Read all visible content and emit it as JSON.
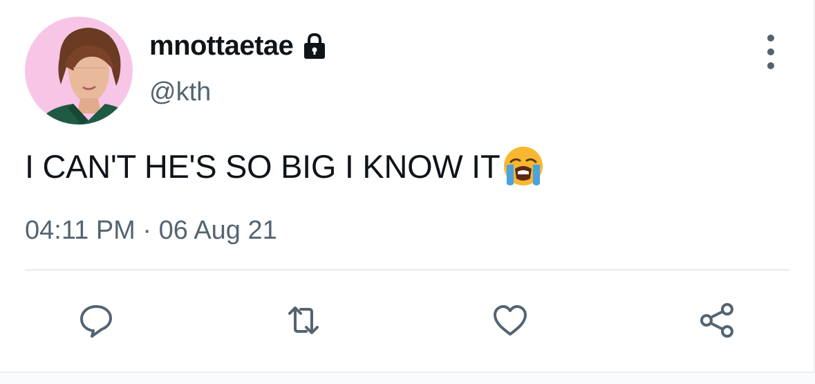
{
  "tweet": {
    "display_name": "mnottaetae",
    "handle": "@kth",
    "text": "I CAN'T HE'S SO BIG I KNOW IT",
    "emoji": "loudly-crying-face",
    "timestamp": "04:11 PM · 06 Aug 21",
    "protected": true
  },
  "actions": {
    "reply": "reply-icon",
    "retweet": "retweet-icon",
    "like": "heart-icon",
    "share": "share-icon"
  },
  "colors": {
    "text_primary": "#0f1419",
    "text_secondary": "#536471",
    "divider": "#e7e9eb",
    "avatar_background": "#f7c6e6"
  }
}
